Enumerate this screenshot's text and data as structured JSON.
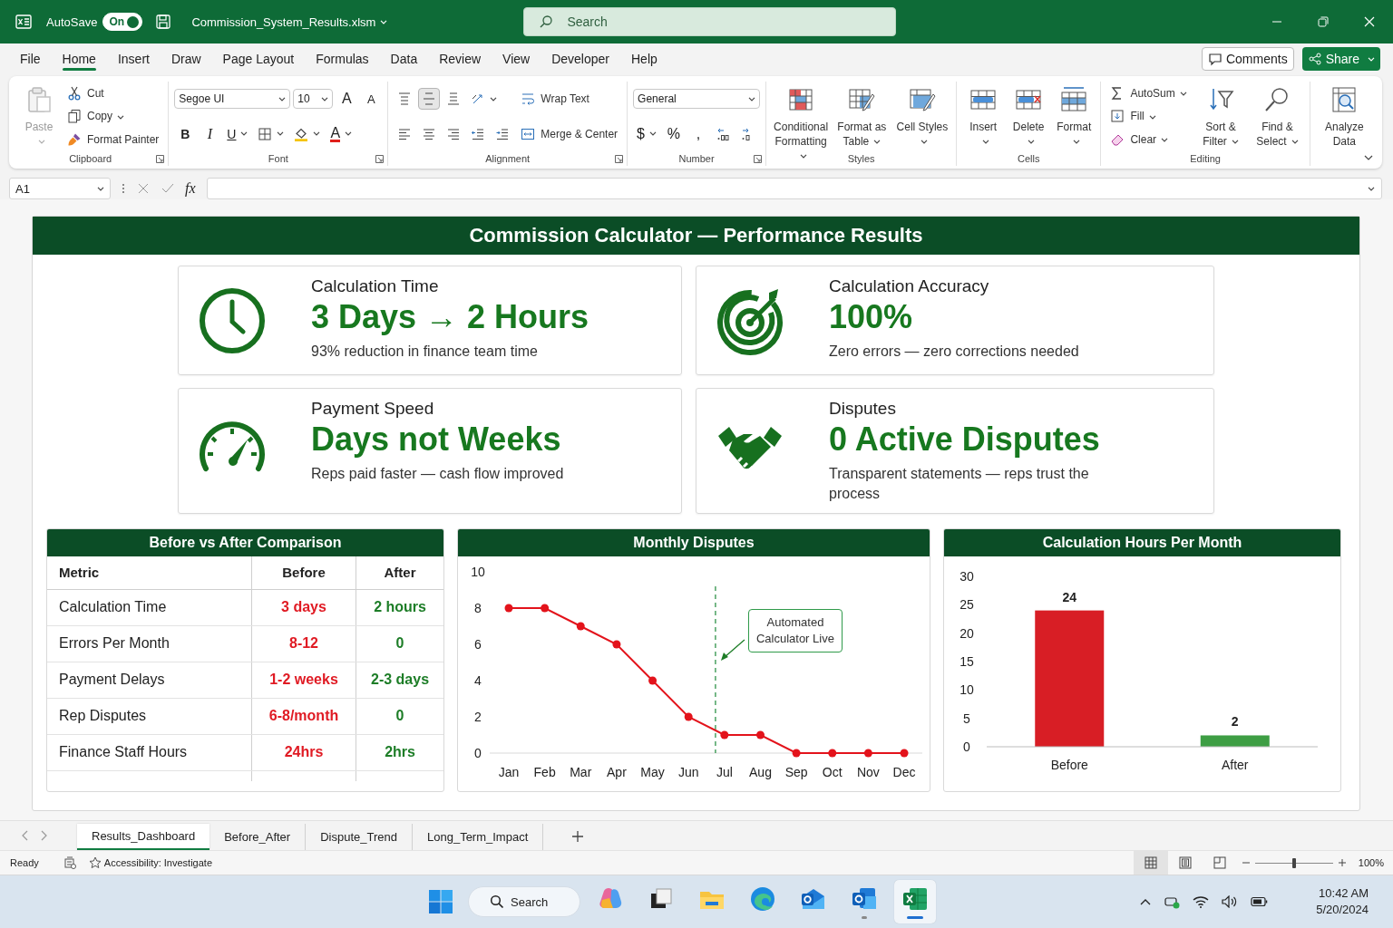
{
  "title_bar": {
    "autosave_label": "AutoSave",
    "autosave_toggle": {
      "label": "On",
      "on": true
    },
    "file_name": "Commission_System_Results.xlsm",
    "search": {
      "placeholder": "Search"
    }
  },
  "menu_tabs": [
    {
      "label": "File",
      "selected": false
    },
    {
      "label": "Home",
      "selected": true
    },
    {
      "label": "Insert",
      "selected": false
    },
    {
      "label": "Draw",
      "selected": false
    },
    {
      "label": "Page Layout",
      "selected": false
    },
    {
      "label": "Formulas",
      "selected": false
    },
    {
      "label": "Data",
      "selected": false
    },
    {
      "label": "Review",
      "selected": false
    },
    {
      "label": "View",
      "selected": false
    },
    {
      "label": "Developer",
      "selected": false
    },
    {
      "label": "Help",
      "selected": false
    }
  ],
  "header_buttons": [
    {
      "kind": "outline",
      "label": "Comments"
    },
    {
      "kind": "primary",
      "label": "Share",
      "caret": true
    }
  ],
  "ribbon": [
    {
      "label": "Clipboard",
      "launcher": true,
      "columns": [
        [
          {
            "kind": "large",
            "label": "Paste",
            "disabled": true,
            "caret": true
          }
        ],
        [
          {
            "kind": "small",
            "label": "Cut"
          },
          {
            "kind": "small",
            "label": "Copy",
            "caret": true
          },
          {
            "kind": "small",
            "label": "Format Painter"
          }
        ]
      ]
    },
    {
      "label": "Font",
      "launcher": true,
      "columns": [
        [
          {
            "kind": "tools",
            "tools": [
              {
                "kind": "font-select",
                "value": "Segoe UI"
              },
              {
                "kind": "size-select",
                "value": "10"
              },
              {
                "kind": "glyph",
                "text": "A"
              },
              {
                "kind": "glyph",
                "text": "A",
                "small": true
              }
            ]
          },
          {
            "kind": "tools",
            "tools": [
              {
                "kind": "bold",
                "text": "B"
              },
              {
                "kind": "italic",
                "text": "I"
              },
              {
                "kind": "underline",
                "text": "U",
                "caret": true
              },
              {
                "kind": "icon",
                "caret": true
              },
              {
                "kind": "icon",
                "caret": true
              },
              {
                "kind": "font-color",
                "text": "A",
                "caret": true
              }
            ]
          }
        ]
      ]
    },
    {
      "label": "Alignment",
      "launcher": true,
      "columns": [
        [
          {
            "kind": "tools",
            "tools": [
              {
                "kind": "icon",
                "selected": false
              },
              {
                "kind": "icon",
                "selected": true
              },
              {
                "kind": "icon",
                "selected": false
              },
              {
                "kind": "icon",
                "caret": true
              }
            ]
          },
          {
            "kind": "tools",
            "tools": [
              {
                "kind": "icon",
                "selected": false
              },
              {
                "kind": "icon",
                "selected": false
              },
              {
                "kind": "icon",
                "selected": false
              },
              {
                "kind": "icon"
              },
              {
                "kind": "icon"
              }
            ]
          }
        ],
        [
          {
            "kind": "small",
            "label": "Wrap Text"
          },
          {
            "kind": "small",
            "label": "Merge & Center"
          }
        ]
      ]
    },
    {
      "label": "Number",
      "launcher": true,
      "columns": [
        [
          {
            "kind": "tools",
            "tools": [
              {
                "kind": "format-select",
                "value": "General"
              }
            ]
          },
          {
            "kind": "tools",
            "tools": [
              {
                "kind": "glyph",
                "text": "$",
                "caret": true
              },
              {
                "kind": "glyph",
                "text": "%"
              },
              {
                "kind": "glyph",
                "text": ","
              },
              {
                "kind": "icon"
              },
              {
                "kind": "icon"
              }
            ]
          }
        ]
      ]
    },
    {
      "label": "Styles",
      "columns": [
        [
          {
            "kind": "large",
            "label": "Conditional Formatting",
            "caret": true
          }
        ],
        [
          {
            "kind": "large",
            "label": "Format as Table",
            "caret": true
          }
        ],
        [
          {
            "kind": "large",
            "label": "Cell Styles",
            "caret": true
          }
        ]
      ]
    },
    {
      "label": "Cells",
      "columns": [
        [
          {
            "kind": "large",
            "label": "Insert",
            "caret": true
          }
        ],
        [
          {
            "kind": "large",
            "label": "Delete",
            "caret": true
          }
        ],
        [
          {
            "kind": "large",
            "label": "Format",
            "caret": true
          }
        ]
      ]
    },
    {
      "label": "Editing",
      "columns": [
        [
          {
            "kind": "small",
            "label": "AutoSum",
            "caret": true
          },
          {
            "kind": "small",
            "label": "Fill",
            "caret": true
          },
          {
            "kind": "small",
            "label": "Clear",
            "caret": true
          }
        ],
        [
          {
            "kind": "large",
            "label": "Sort & Filter",
            "caret": true
          }
        ],
        [
          {
            "kind": "large",
            "label": "Find & Select",
            "caret": true
          }
        ]
      ]
    },
    {
      "columns": [
        [
          {
            "kind": "large",
            "label": "Analyze Data"
          }
        ]
      ]
    }
  ],
  "formula_bar": {
    "name_box": "A1",
    "function_label": "fx"
  },
  "dashboard": {
    "title": "Commission Calculator — Performance Results",
    "kpis": [
      {
        "heading": "Calculation Time",
        "value": "3 Days → 2 Hours",
        "note": "93% reduction in finance team time"
      },
      {
        "heading": "Calculation Accuracy",
        "value": "100%",
        "note": "Zero errors — zero corrections needed"
      },
      {
        "heading": "Payment Speed",
        "value": "Days not Weeks",
        "note": "Reps paid faster — cash flow improved"
      },
      {
        "heading": "Disputes",
        "value": "0 Active Disputes",
        "note": "Transparent statements — reps trust the process"
      }
    ],
    "comparison_table": {
      "title": "Before vs After Comparison",
      "columns": [
        {
          "label": "Metric"
        },
        {
          "label": "Before",
          "color": "#e01b24"
        },
        {
          "label": "After",
          "color": "#1d7d27"
        }
      ],
      "rows": [
        [
          "Calculation Time",
          "3 days",
          "2 hours"
        ],
        [
          "Errors Per Month",
          "8-12",
          "0"
        ],
        [
          "Payment Delays",
          "1-2 weeks",
          "2-3 days"
        ],
        [
          "Rep Disputes",
          "6-8/month",
          "0"
        ],
        [
          "Finance Staff Hours",
          "24hrs",
          "2hrs"
        ]
      ]
    },
    "dispute_chart": {
      "chart_data": {
        "type": "line",
        "title": "Monthly Disputes",
        "categories": [
          "Jan",
          "Feb",
          "Mar",
          "Apr",
          "May",
          "Jun",
          "Jul",
          "Aug",
          "Sep",
          "Oct",
          "Nov",
          "Dec"
        ],
        "series": [
          {
            "color": "#e3131b",
            "marker": "o",
            "values": [
              8,
              8,
              7,
              6,
              4,
              2,
              1,
              1,
              0,
              0,
              0,
              0
            ]
          }
        ],
        "ylim": [
          0,
          10
        ],
        "yticks": [
          {
            "value": 0,
            "label": "0"
          },
          {
            "value": 2,
            "label": "2"
          },
          {
            "value": 4,
            "label": "4"
          },
          {
            "value": 6,
            "label": "6"
          },
          {
            "value": 8,
            "label": "8"
          },
          {
            "value": 10,
            "label": "10"
          }
        ],
        "ref_lines": [
          {
            "axis": "x",
            "value": "Jul",
            "color": "#1d8a3a"
          }
        ],
        "annotations": [
          "Automated Calculator Live"
        ]
      }
    },
    "hours_chart": {
      "chart_data": {
        "type": "bar",
        "title": "Calculation Hours Per Month",
        "categories": [
          "Before",
          "After"
        ],
        "series": [
          {
            "color": "#d81e25",
            "values": [
              24,
              null
            ]
          },
          {
            "color": "#3e9e44",
            "values": [
              null,
              2
            ]
          }
        ],
        "ylim": [
          0,
          30
        ],
        "yticks": [
          {
            "value": 0,
            "label": "0"
          },
          {
            "value": 5,
            "label": "5"
          },
          {
            "value": 10,
            "label": "10"
          },
          {
            "value": 15,
            "label": "15"
          },
          {
            "value": 20,
            "label": "20"
          },
          {
            "value": 25,
            "label": "25"
          },
          {
            "value": 30,
            "label": "30"
          }
        ],
        "data_labels": true
      }
    }
  },
  "sheet_tabs": [
    {
      "label": "Results_Dashboard",
      "selected": true
    },
    {
      "label": "Before_After",
      "selected": false
    },
    {
      "label": "Dispute_Trend",
      "selected": false
    },
    {
      "label": "Long_Term_Impact",
      "selected": false
    }
  ],
  "status_bar": {
    "ready": "Ready",
    "accessibility": "Accessibility: Investigate",
    "views": [
      {
        "selected": true
      },
      {
        "selected": false
      },
      {
        "selected": false
      }
    ],
    "zoom": {
      "level": 0.5,
      "reading": "100%"
    }
  },
  "taskbar": {
    "search": {
      "placeholder": "Search"
    },
    "apps": [
      {
        "selected": false,
        "running": false
      },
      {
        "selected": false,
        "running": false
      },
      {
        "selected": false,
        "running": false
      },
      {
        "selected": false,
        "running": false
      },
      {
        "selected": false,
        "running": false
      },
      {
        "selected": false,
        "running": true
      },
      {
        "selected": true,
        "running": true
      }
    ],
    "time": "10:42 AM",
    "date": "5/20/2024"
  }
}
